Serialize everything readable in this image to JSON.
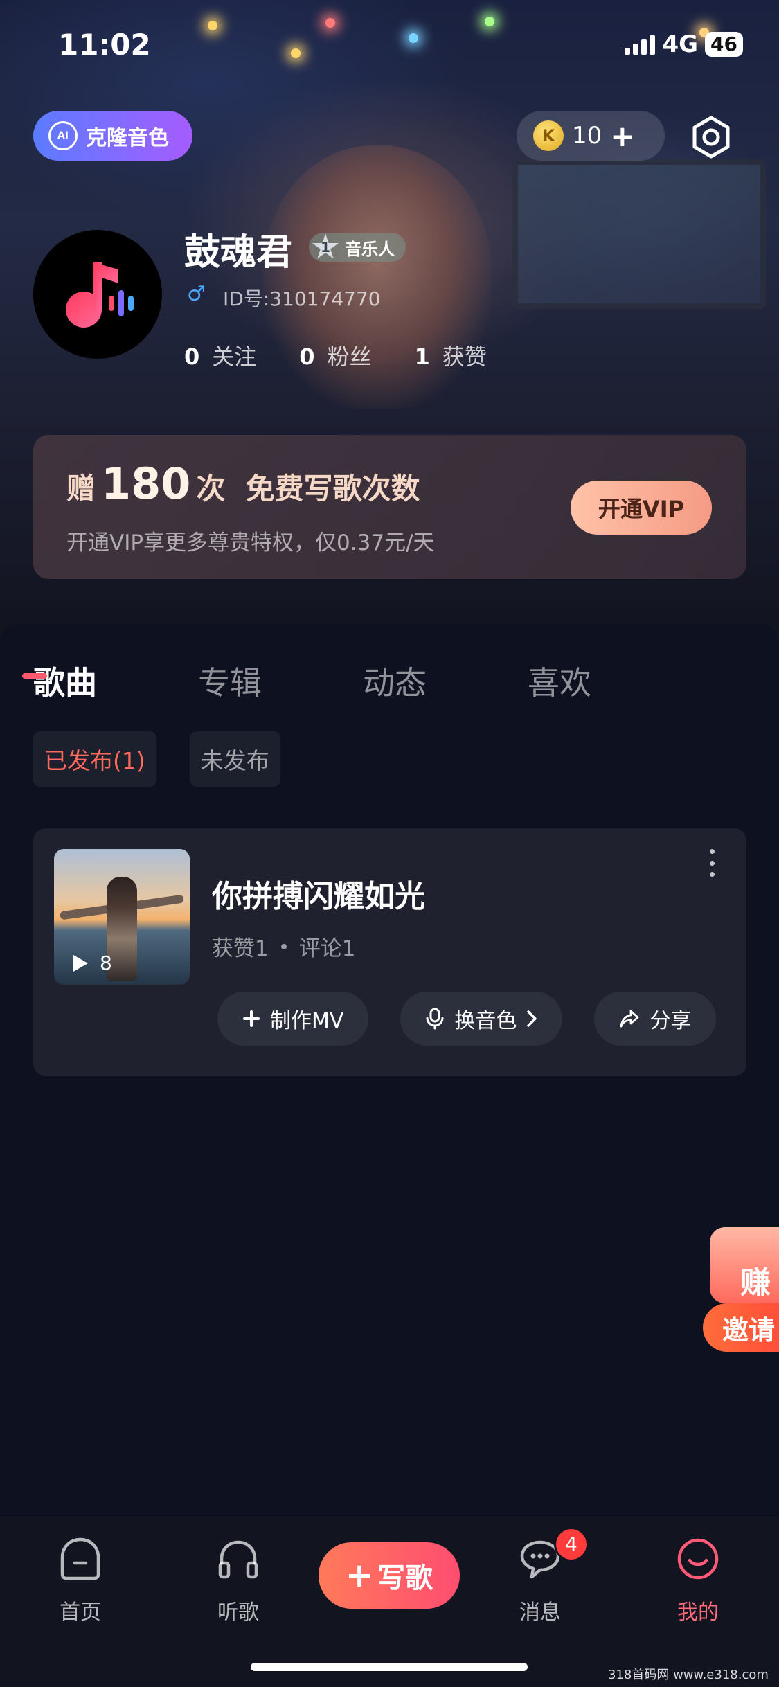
{
  "status_bar": {
    "time": "11:02",
    "network": "4G",
    "battery": "46"
  },
  "header": {
    "clone_voice_label": "克隆音色",
    "ai_icon_text": "AI",
    "coin_symbol": "K",
    "coin_count": "10",
    "coin_add": "+"
  },
  "profile": {
    "name": "鼓魂君",
    "level": "1",
    "level_label": "音乐人",
    "id_text": "ID号:310174770",
    "stats": [
      {
        "value": "0",
        "label": "关注"
      },
      {
        "value": "0",
        "label": "粉丝"
      },
      {
        "value": "1",
        "label": "获赞"
      }
    ]
  },
  "vip_banner": {
    "title_prefix": "赠",
    "title_number": "180",
    "title_suffix": "次  免费写歌次数",
    "subtitle": "开通VIP享更多尊贵特权，仅0.37元/天",
    "button_label": "开通VIP"
  },
  "tabs": [
    "歌曲",
    "专辑",
    "动态",
    "喜欢"
  ],
  "filters": [
    {
      "label": "已发布(1)",
      "active": true
    },
    {
      "label": "未发布",
      "active": false
    }
  ],
  "song": {
    "title": "你拼搏闪耀如光",
    "play_count": "8",
    "likes": "获赞1",
    "comments": "评论1",
    "actions": [
      "制作MV",
      "换音色",
      "分享"
    ]
  },
  "invite": {
    "earn_label": "赚",
    "invite_label": "邀请"
  },
  "bottom_nav": {
    "items": [
      {
        "label": "首页"
      },
      {
        "label": "听歌"
      },
      {
        "label": "写歌",
        "prefix": "+"
      },
      {
        "label": "消息",
        "badge": "4"
      },
      {
        "label": "我的"
      }
    ]
  },
  "watermark": "318首码网 www.e318.com",
  "colors": {
    "accent": "#ff5a6e",
    "vip_button": "#f59b85",
    "clone_gradient_start": "#5b7cff",
    "clone_gradient_end": "#a65cff"
  }
}
